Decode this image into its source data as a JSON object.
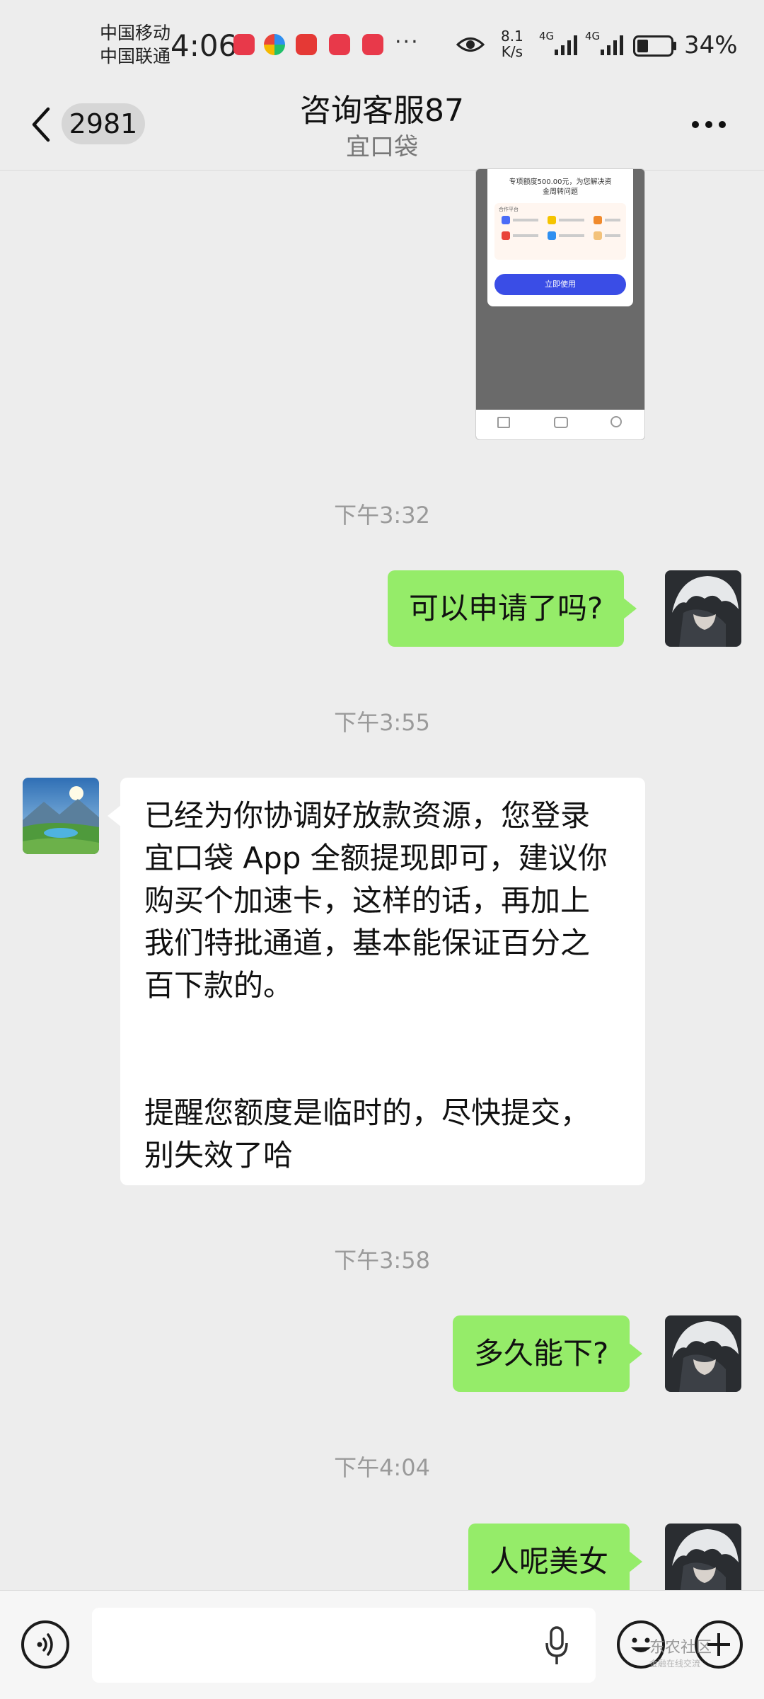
{
  "status_bar": {
    "carrier_1": "中国移动",
    "carrier_2": "中国联通",
    "time": "4:06",
    "more": "···",
    "net_speed_value": "8.1",
    "net_speed_unit": "K/s",
    "sim1_type": "4G",
    "sim2_type": "4G",
    "battery_percent": "34%",
    "battery_level": 0.34
  },
  "title_bar": {
    "unread_count": "2981",
    "title": "咨询客服87",
    "subtitle": "宜口袋"
  },
  "shared_image": {
    "line1": "专项额度500.00元，为您解决资",
    "line2": "金周转问题",
    "section": "合作平台",
    "button": "立即使用"
  },
  "messages": [
    {
      "type": "time",
      "text": "下午3:32"
    },
    {
      "type": "outgoing",
      "text": "可以申请了吗?"
    },
    {
      "type": "time",
      "text": "下午3:55"
    },
    {
      "type": "incoming",
      "lines": [
        "已经为你协调好放款资源，您登录",
        "宜口袋 App 全额提现即可，建议你",
        "购买个加速卡，这样的话，再加上",
        "我们特批通道，基本能保证百分之",
        "百下款的。",
        "",
        "",
        "提醒您额度是临时的，尽快提交，",
        "别失效了哈"
      ]
    },
    {
      "type": "time",
      "text": "下午3:58"
    },
    {
      "type": "outgoing",
      "text": "多久能下?"
    },
    {
      "type": "time",
      "text": "下午4:04"
    },
    {
      "type": "outgoing",
      "text": "人呢美女"
    }
  ],
  "input_bar": {
    "input_value": "",
    "watermark": "东农社区",
    "watermark_sub": "金融在线交流"
  },
  "icons": {
    "back": "chevron-left-icon",
    "more": "more-dots-icon",
    "voice": "voice-icon",
    "mic": "microphone-icon",
    "emoji": "emoji-icon",
    "add": "plus-icon",
    "eye": "eye-icon"
  },
  "colors": {
    "outgoing_bubble": "#95ec69",
    "incoming_bubble": "#ffffff",
    "background": "#ededed",
    "image_button": "#3a4de6"
  }
}
